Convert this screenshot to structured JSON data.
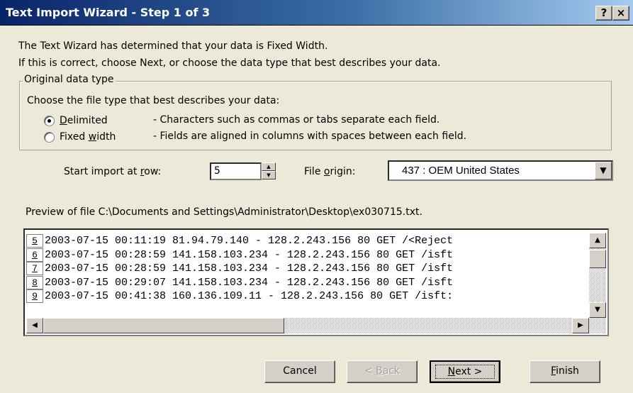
{
  "window": {
    "title": "Text Import Wizard - Step 1 of 3",
    "help_label": "?",
    "close_label": "×"
  },
  "intro": {
    "line1": "The Text Wizard has determined that your data is Fixed Width.",
    "line2": "If this is correct, choose Next, or choose the data type that best describes your data."
  },
  "original_type": {
    "legend": "Original data type",
    "description": "Choose the file type that best describes your data:",
    "options": [
      {
        "label_pre": "",
        "mnemonic": "D",
        "label_post": "elimited",
        "help": "- Characters such as commas or tabs separate each field.",
        "checked": true
      },
      {
        "label_pre": "Fixed ",
        "mnemonic": "w",
        "label_post": "idth",
        "help": "- Fields are aligned in columns with spaces between each field.",
        "checked": false
      }
    ]
  },
  "start_row": {
    "label_pre": "Start import at ",
    "mnemonic": "r",
    "label_post": "ow:",
    "value": "5"
  },
  "file_origin": {
    "label_pre": "File ",
    "mnemonic": "o",
    "label_post": "rigin:",
    "value": "437 : OEM United States"
  },
  "preview": {
    "label": "Preview of file C:\\Documents and Settings\\Administrator\\Desktop\\ex030715.txt.",
    "lines": [
      {
        "num": "5",
        "text": "2003-07-15 00:11:19 81.94.79.140 - 128.2.243.156 80 GET /<Reject"
      },
      {
        "num": "6",
        "text": "2003-07-15 00:28:59 141.158.103.234 - 128.2.243.156 80 GET /isft"
      },
      {
        "num": "7",
        "text": "2003-07-15 00:28:59 141.158.103.234 - 128.2.243.156 80 GET /isft"
      },
      {
        "num": "8",
        "text": "2003-07-15 00:29:07 141.158.103.234 - 128.2.243.156 80 GET /isft"
      },
      {
        "num": "9",
        "text": "2003-07-15 00:41:38 160.136.109.11 - 128.2.243.156 80 GET /isft:"
      }
    ]
  },
  "buttons": {
    "cancel": "Cancel",
    "back_pre": "< ",
    "back_mnemonic": "B",
    "back_post": "ack",
    "next_mnemonic": "N",
    "next_post": "ext >",
    "finish_mnemonic": "F",
    "finish_post": "inish"
  },
  "colors": {
    "title_gradient_start": "#0a246a",
    "title_gradient_end": "#a6caf0",
    "dialog_bg": "#ece9d8"
  }
}
